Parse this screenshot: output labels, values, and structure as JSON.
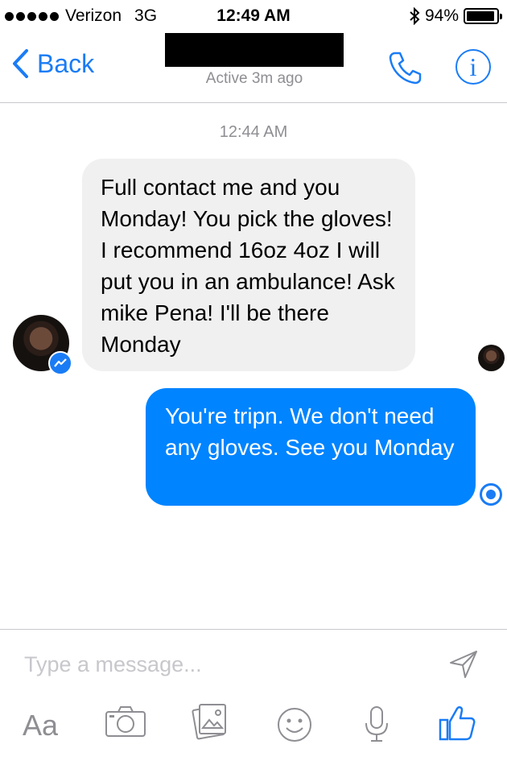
{
  "status_bar": {
    "carrier": "Verizon",
    "network": "3G",
    "time": "12:49 AM",
    "battery": "94%",
    "battery_level": 0.94
  },
  "nav": {
    "back_label": "Back",
    "status": "Active 3m ago",
    "info_glyph": "i"
  },
  "conversation": {
    "timestamp": "12:44 AM",
    "messages": [
      {
        "direction": "incoming",
        "text": "Full contact me and you Monday! You pick the gloves! I recommend 16oz 4oz I will put you in an ambulance! Ask mike Pena! I'll be there Monday"
      },
      {
        "direction": "outgoing",
        "text": "You're tripn. We don't need any gloves. See you Monday"
      }
    ]
  },
  "composer": {
    "placeholder": "Type a message...",
    "text_button": "Aa",
    "icons": [
      "send-icon",
      "camera-icon",
      "photo-icon",
      "emoji-icon",
      "microphone-icon",
      "thumbs-up-icon"
    ]
  },
  "colors": {
    "accent": "#1a7cf5",
    "outgoing_bubble": "#0084ff",
    "incoming_bubble": "#f1f0f0",
    "secondary_text": "#8e8e93"
  }
}
